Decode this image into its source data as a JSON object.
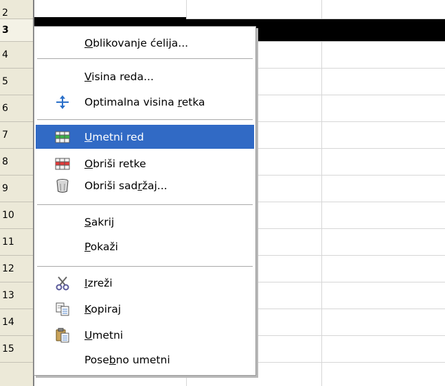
{
  "row_headers": [
    "2",
    "3",
    "4",
    "5",
    "6",
    "7",
    "8",
    "9",
    "10",
    "11",
    "12",
    "13",
    "14",
    "15"
  ],
  "context_menu": {
    "items": [
      {
        "id": "format-cells",
        "pre": "",
        "key": "O",
        "post": "blikovanje ćelija..."
      },
      {
        "id": "row-height",
        "pre": "",
        "key": "V",
        "post": "isina reda..."
      },
      {
        "id": "optimal-row-height",
        "pre": "Optimalna visina ",
        "key": "r",
        "post": "etka"
      },
      {
        "id": "insert-row",
        "pre": "",
        "key": "U",
        "post": "metni red"
      },
      {
        "id": "delete-rows",
        "pre": "",
        "key": "O",
        "post": "briši retke"
      },
      {
        "id": "delete-contents",
        "pre": "Obriši sad",
        "key": "r",
        "post": "žaj..."
      },
      {
        "id": "hide",
        "pre": "",
        "key": "S",
        "post": "akrij"
      },
      {
        "id": "show",
        "pre": "",
        "key": "P",
        "post": "okaži"
      },
      {
        "id": "cut",
        "pre": "",
        "key": "I",
        "post": "zreži"
      },
      {
        "id": "copy",
        "pre": "",
        "key": "K",
        "post": "opiraj"
      },
      {
        "id": "paste",
        "pre": "",
        "key": "U",
        "post": "metni"
      },
      {
        "id": "paste-special",
        "pre": "Pose",
        "key": "b",
        "post": "no umetni"
      }
    ]
  },
  "icons": {
    "optimal-row-height": "resize-vertical-icon",
    "insert-row": "insert-row-icon",
    "delete-rows": "delete-rows-icon",
    "delete-contents": "trash-can-icon",
    "cut": "scissors-icon",
    "copy": "copy-icon",
    "paste": "paste-icon"
  },
  "colors": {
    "highlight": "#316ac5",
    "selected_row": "#000000",
    "header_bg": "#ece9d8"
  }
}
